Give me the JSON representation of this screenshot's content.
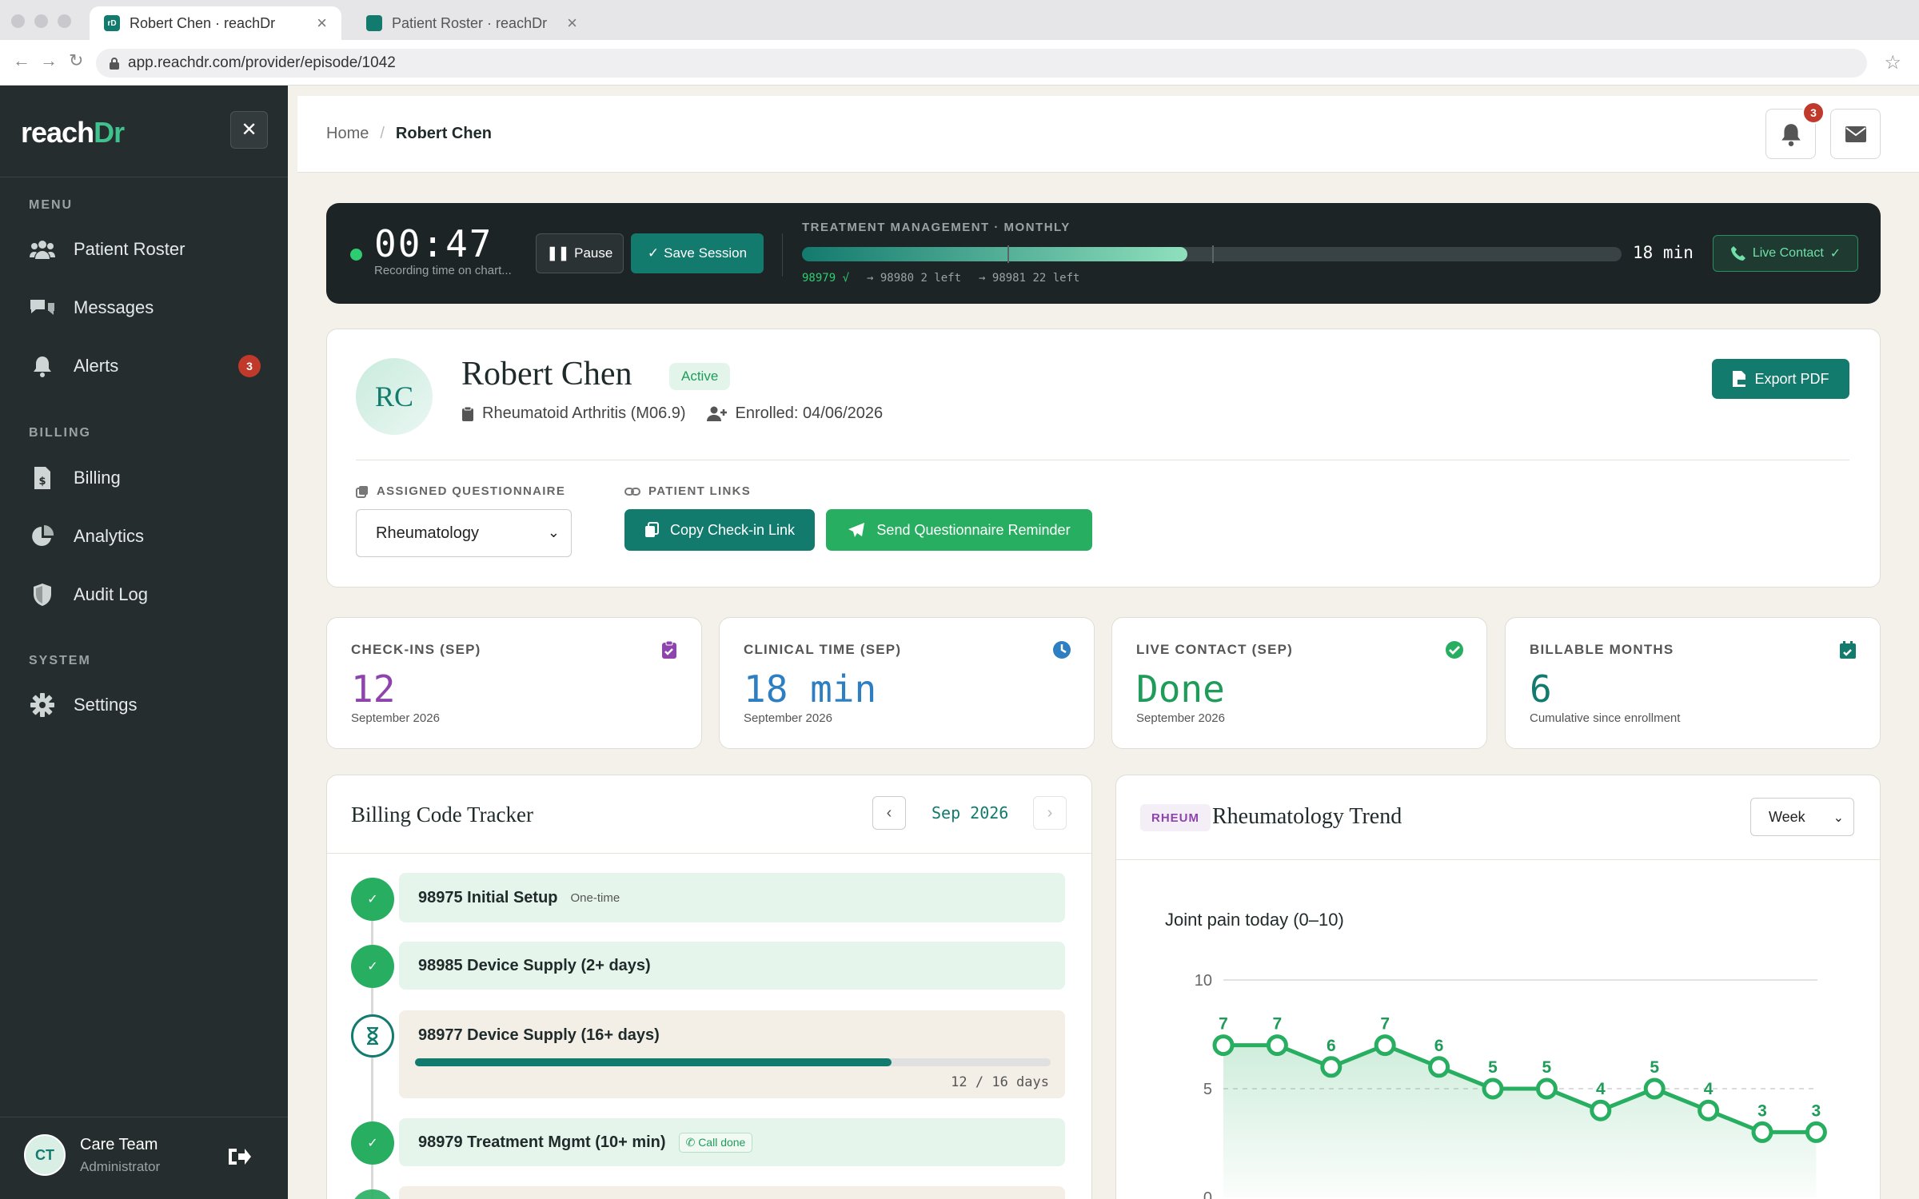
{
  "browser": {
    "tabs": [
      {
        "label": "Robert Chen · reachDr",
        "favicon": "rD"
      },
      {
        "label": "Patient Roster · reachDr"
      }
    ],
    "url": "app.reachdr.com/provider/episode/1042"
  },
  "sidebar": {
    "logo_a": "reach",
    "logo_b": "Dr",
    "sections": {
      "menu": "MENU",
      "billing": "BILLING",
      "system": "SYSTEM"
    },
    "items": [
      {
        "label": "Patient Roster",
        "icon": "users-icon"
      },
      {
        "label": "Messages",
        "icon": "chat-icon"
      },
      {
        "label": "Alerts",
        "icon": "bell-icon",
        "badge": "3"
      },
      {
        "label": "Billing",
        "icon": "invoice-icon"
      },
      {
        "label": "Analytics",
        "icon": "pie-chart-icon"
      },
      {
        "label": "Audit Log",
        "icon": "shield-icon"
      },
      {
        "label": "Settings",
        "icon": "gear-icon"
      }
    ],
    "user": {
      "initials": "CT",
      "name": "Care Team",
      "role": "Administrator"
    }
  },
  "header": {
    "breadcrumb": {
      "home": "Home",
      "sep": "/",
      "current": "Robert Chen"
    },
    "notification_count": "3"
  },
  "session": {
    "timer": "00:47",
    "timer_sub": "Recording time on chart...",
    "pause_label": "Pause",
    "save_label": "Save Session",
    "tm_label": "TREATMENT MANAGEMENT · MONTHLY",
    "progress_fraction": 0.47,
    "minutes_label": "18 min",
    "codes": [
      {
        "text": "98979 √",
        "status": "met"
      },
      {
        "text": "→ 98980 2 left",
        "status": "pending"
      },
      {
        "text": "→ 98981 22 left",
        "status": "pending"
      }
    ],
    "live_contact_label": "Live Contact"
  },
  "patient": {
    "initials": "RC",
    "name": "Robert Chen",
    "status": "Active",
    "diagnosis": "Rheumatoid Arthritis (M06.9)",
    "enrolled": "Enrolled: 04/06/2026",
    "export_label": "Export PDF",
    "questionnaire_label": "ASSIGNED QUESTIONNAIRE",
    "questionnaire_value": "Rheumatology",
    "links_label": "PATIENT LINKS",
    "copy_link_label": "Copy Check-in Link",
    "reminder_label": "Send Questionnaire Reminder"
  },
  "stats": [
    {
      "label": "CHECK-INS (SEP)",
      "value": "12",
      "sub": "September 2026",
      "color": "#8e44ad",
      "icon": "clipboard-check-icon"
    },
    {
      "label": "CLINICAL TIME (SEP)",
      "value": "18 min",
      "sub": "September 2026",
      "color": "#2d7fc1",
      "icon": "clock-icon"
    },
    {
      "label": "LIVE CONTACT (SEP)",
      "value": "Done",
      "sub": "September 2026",
      "color": "#1f9b5a",
      "icon": "check-circle-icon"
    },
    {
      "label": "BILLABLE MONTHS",
      "value": "6",
      "sub": "Cumulative since enrollment",
      "color": "#137a6e",
      "icon": "calendar-check-icon"
    }
  ],
  "tracker": {
    "title": "Billing Code Tracker",
    "month": "Sep 2026",
    "items": [
      {
        "label": "98975 Initial Setup",
        "tag": "One-time",
        "status": "done"
      },
      {
        "label": "98985 Device Supply (2+ days)",
        "status": "done"
      },
      {
        "label": "98977 Device Supply (16+ days)",
        "status": "pending",
        "progress": 0.75,
        "days": "12 / 16 days"
      },
      {
        "label": "98979 Treatment Mgmt (10+ min)",
        "chip": "Call done",
        "status": "done"
      }
    ]
  },
  "trend": {
    "tag": "RHEUM",
    "title": "Rheumatology Trend",
    "range": "Week"
  },
  "chart_data": {
    "type": "line",
    "title": "Joint pain today (0–10)",
    "y_ticks": [
      10,
      5,
      0
    ],
    "ylim": [
      0,
      10
    ],
    "values": [
      7,
      7,
      6,
      7,
      6,
      5,
      5,
      4,
      5,
      4,
      3,
      3
    ],
    "color": "#27ae60",
    "reference_line": 5
  }
}
